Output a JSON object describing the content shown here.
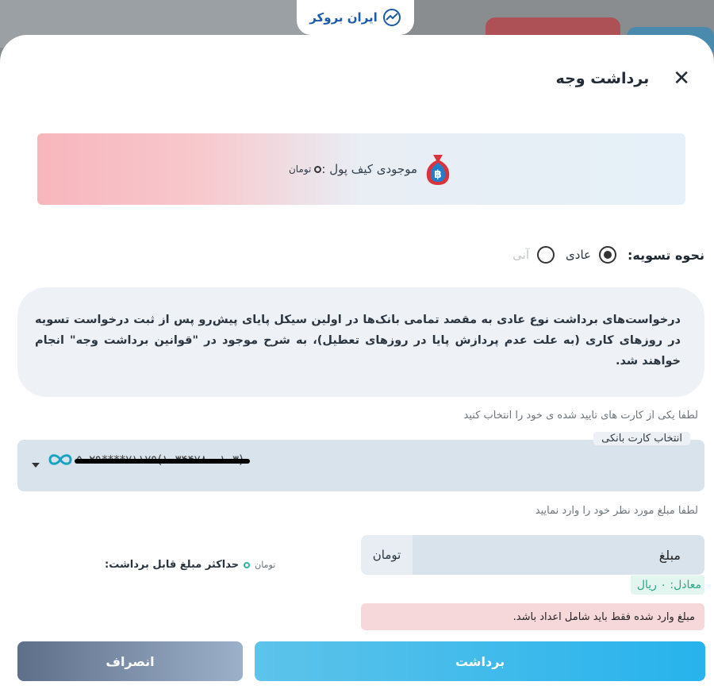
{
  "logo": {
    "text": "ایران بروکر"
  },
  "modal": {
    "title": "برداشت وجه",
    "close_icon": "close-icon",
    "balance": {
      "label": "موجودی کیف پول :",
      "value": "۰",
      "unit": "تومان",
      "icon": "money-bag-bitcoin-icon"
    },
    "settlement": {
      "label": "نحوه تسویه:",
      "options": [
        {
          "label": "عادی",
          "selected": true,
          "disabled": false
        },
        {
          "label": "آنی",
          "selected": false,
          "disabled": true
        }
      ]
    },
    "info_text": "درخواست‌های برداشت نوع عادی به مقصد تمامی بانک‌ها در اولین سیکل پایای پیش‌رو پس از ثبت درخواست تسویه در روزهای کاری (به علت عدم پردازش پایا در روزهای تعطیل)، به شرح موجود در \"قوانین برداشت وجه\" انجام خواهند شد.",
    "card_hint": "لطفا یکی از کارت های تایید شده ی خود را انتخاب کنید",
    "card_select": {
      "label": "انتخاب کارت بانکی",
      "value": "۵۰۲۹****۷۱۱۷۹(۱۰۳۴۴۷۸۰۰۱۰۳)",
      "icon": "bank-logo-icon"
    },
    "amount_hint": "لطفا مبلغ مورد نظر خود را وارد نمایید",
    "amount": {
      "placeholder": "مبلغ",
      "unit": "تومان"
    },
    "max": {
      "label": "حداکثر مبلغ قابل برداشت:",
      "value": "۰",
      "unit": "تومان"
    },
    "equivalent": "معادل: ۰ ریال",
    "error": "مبلغ وارد شده فقط باید شامل اعداد باشد.",
    "buttons": {
      "withdraw": "برداشت",
      "cancel": "انصراف"
    }
  },
  "colors": {
    "primary": "#27b3ec",
    "cancel": "#5d6f89",
    "error_bg": "#f6d7da",
    "equiv_text": "#2aa686",
    "brand": "#1a5aa8"
  }
}
